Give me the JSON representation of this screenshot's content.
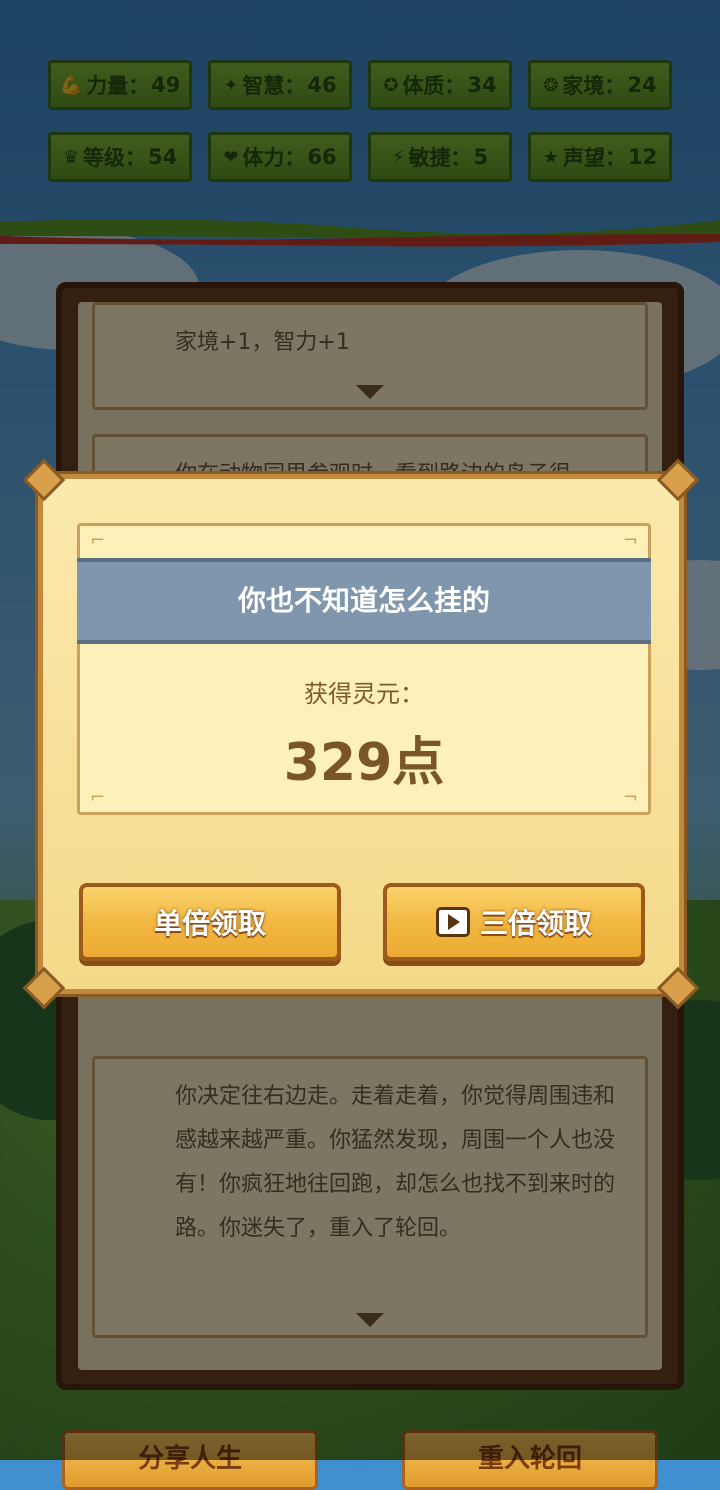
{
  "stats": [
    {
      "icon": "strength-icon",
      "glyph": "💪",
      "label": "力量：",
      "value": "49"
    },
    {
      "icon": "bulb-icon",
      "glyph": "✦",
      "label": "智慧：",
      "value": "46"
    },
    {
      "icon": "constitution-icon",
      "glyph": "✪",
      "label": "体质：",
      "value": "34"
    },
    {
      "icon": "family-icon",
      "glyph": "❂",
      "label": "家境：",
      "value": "24"
    },
    {
      "icon": "crown-icon",
      "glyph": "♛",
      "label": "等级：",
      "value": "54"
    },
    {
      "icon": "heart-icon",
      "glyph": "❤",
      "label": "体力：",
      "value": "66"
    },
    {
      "icon": "lightning-icon",
      "glyph": "⚡",
      "label": "敏捷：",
      "value": "5"
    },
    {
      "icon": "star-icon",
      "glyph": "★",
      "label": "声望：",
      "value": "12"
    }
  ],
  "log": {
    "event1": "家境+1，智力+1",
    "event2": "你在动物园里参观时，看到路边的鸟子很",
    "event3": "你决定往右边走。走着走着，你觉得周围违和感越来越严重。你猛然发现，周围一个人也没有！你疯狂地往回跑，却怎么也找不到来时的路。你迷失了，重入了轮回。"
  },
  "modal": {
    "title": "你也不知道怎么挂的",
    "reward_label": "获得灵元：",
    "reward_value": "329点",
    "single_button": "单倍领取",
    "triple_button": "三倍领取"
  },
  "bottom": {
    "left_button": "分享人生",
    "right_button": "重入轮回"
  }
}
